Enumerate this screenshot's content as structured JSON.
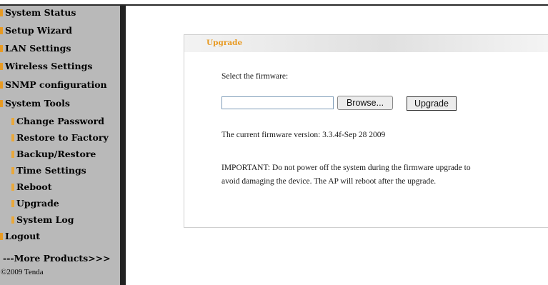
{
  "sidebar": {
    "items": [
      {
        "label": "System Status",
        "sub": false
      },
      {
        "label": "Setup Wizard",
        "sub": false
      },
      {
        "label": "LAN Settings",
        "sub": false
      },
      {
        "label": "Wireless Settings",
        "sub": false
      },
      {
        "label": "SNMP configuration",
        "sub": false
      },
      {
        "label": "System Tools",
        "sub": false
      },
      {
        "label": "Change Password",
        "sub": true
      },
      {
        "label": "Restore to Factory",
        "sub": true
      },
      {
        "label": "Backup/Restore",
        "sub": true
      },
      {
        "label": "Time Settings",
        "sub": true
      },
      {
        "label": "Reboot",
        "sub": true
      },
      {
        "label": "Upgrade",
        "sub": true
      },
      {
        "label": "System Log",
        "sub": true
      },
      {
        "label": "Logout",
        "sub": false
      }
    ],
    "more_products": "---More Products>>>",
    "copyright": "©2009 Tenda"
  },
  "panel": {
    "title": "Upgrade",
    "select_label": "Select the firmware:",
    "file_value": "",
    "browse_label": "Browse...",
    "upgrade_label": "Upgrade",
    "version_text": "The current firmware version: 3.3.4f-Sep 28 2009",
    "important_line1": "IMPORTANT: Do not power off the system during the firmware upgrade to",
    "important_line2": "avoid damaging the device. The AP will reboot after the upgrade."
  },
  "colors": {
    "accent": "#e89a22",
    "sidebar_bg": "#b9b9b9"
  }
}
